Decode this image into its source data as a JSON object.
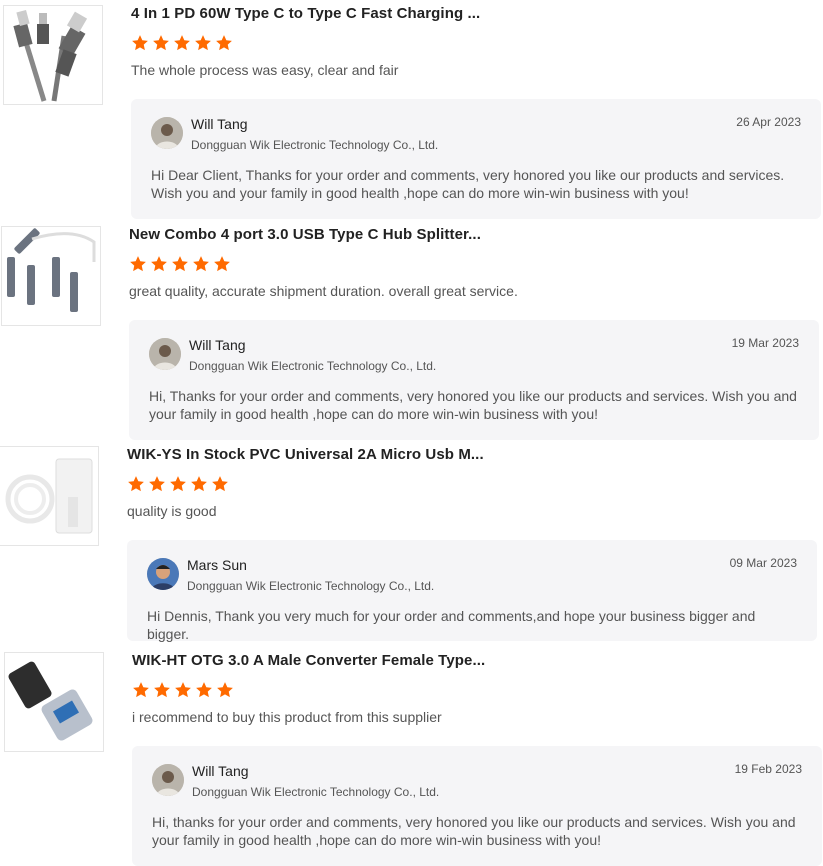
{
  "reviews": [
    {
      "product_title": "4 In 1 PD 60W Type C to Type C Fast Charging ...",
      "rating": 5,
      "comment": "The whole process was easy, clear and fair",
      "reply": {
        "name": "Will Tang",
        "company": "Dongguan Wik Electronic Technology Co., Ltd.",
        "date": "26 Apr 2023",
        "text": "Hi Dear Client, Thanks for your order and comments, very honored you like our products and services. Wish you and your family in good health ,hope can do more win-win business with you!"
      }
    },
    {
      "product_title": "New Combo 4 port 3.0 USB Type C Hub Splitter...",
      "rating": 5,
      "comment": "great quality, accurate shipment duration. overall great service.",
      "reply": {
        "name": "Will Tang",
        "company": "Dongguan Wik Electronic Technology Co., Ltd.",
        "date": "19 Mar 2023",
        "text": "Hi, Thanks for your order and comments, very honored you like our products and services. Wish you and your family in good health ,hope can do more win-win business with you!"
      }
    },
    {
      "product_title": "WIK-YS In Stock PVC Universal 2A Micro Usb M...",
      "rating": 5,
      "comment": "quality is good",
      "reply": {
        "name": "Mars Sun",
        "company": "Dongguan Wik Electronic Technology Co., Ltd.",
        "date": "09 Mar 2023",
        "text": "Hi Dennis, Thank you very much for your order and comments,and hope your business bigger and bigger."
      }
    },
    {
      "product_title": "WIK-HT OTG 3.0 A Male Converter Female Type...",
      "rating": 5,
      "comment": "i recommend to buy this product from this supplier",
      "reply": {
        "name": "Will Tang",
        "company": "Dongguan Wik Electronic Technology Co., Ltd.",
        "date": "19 Feb 2023",
        "text": "Hi, thanks for your order and comments, very honored you like our products and services. Wish you and your family in good health ,hope can do more win-win business with you!"
      }
    }
  ],
  "colors": {
    "star": "#ff6a00",
    "reply_bg": "#f5f5f7"
  },
  "icons": {
    "star": "star-icon",
    "avatar": "user-avatar"
  }
}
